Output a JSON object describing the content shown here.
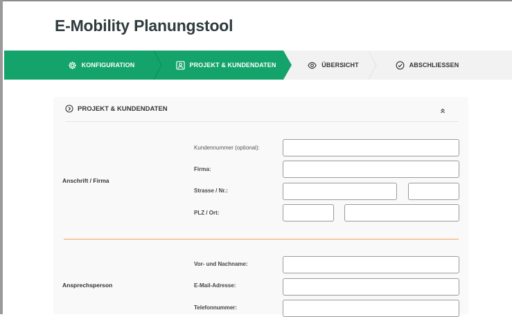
{
  "app": {
    "title": "E-Mobility Planungstool"
  },
  "stepper": {
    "steps": [
      {
        "label": "KONFIGURATION",
        "icon": "gear-icon",
        "state": "done"
      },
      {
        "label": "PROJEKT & KUNDENDATEN",
        "icon": "user-card-icon",
        "state": "active"
      },
      {
        "label": "ÜBERSICHT",
        "icon": "eye-icon",
        "state": "pending"
      },
      {
        "label": "ABSCHLIESSEN",
        "icon": "check-circle-icon",
        "state": "pending"
      }
    ],
    "colors": {
      "active": "#14a36b",
      "pending": "#f2f2f2"
    }
  },
  "card": {
    "title": "PROJEKT & KUNDENDATEN",
    "title_icon": "arrow-circle-right-icon",
    "collapse_icon": "chevrons-up-icon"
  },
  "address_section": {
    "label": "Anschrift / Firma",
    "fields": {
      "customer_number": {
        "label": "Kundennummer (optional):",
        "value": ""
      },
      "company": {
        "label": "Firma:",
        "value": ""
      },
      "street": {
        "label": "Strasse / Nr.:",
        "street_value": "",
        "number_value": ""
      },
      "city": {
        "label": "PLZ / Ort:",
        "zip_value": "",
        "city_value": ""
      }
    }
  },
  "contact_section": {
    "label": "Ansprechsperson",
    "fields": {
      "name": {
        "label": "Vor- und Nachname:",
        "value": ""
      },
      "email": {
        "label": "E-Mail-Adresse:",
        "value": ""
      },
      "phone": {
        "label": "Telefonnummer:",
        "value": ""
      }
    }
  },
  "colors": {
    "divider": "#f5a25d"
  }
}
